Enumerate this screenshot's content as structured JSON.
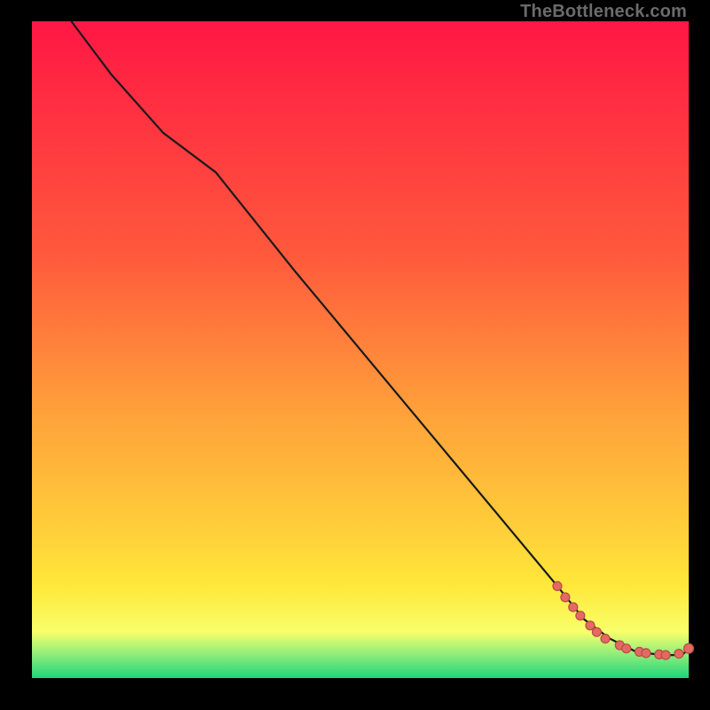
{
  "watermark": "TheBottleneck.com",
  "colors": {
    "gradient": [
      "#ff1744",
      "#ff5a3c",
      "#ffa23a",
      "#ffd03a",
      "#ffe83a",
      "#f8ff6a",
      "#9aef7a",
      "#1fd67a"
    ],
    "dot_fill": "#e36a62",
    "dot_stroke": "#b84b44",
    "curve": "#1a1a1a"
  },
  "chart_data": {
    "type": "line",
    "title": "",
    "xlabel": "",
    "ylabel": "",
    "xlim": [
      0,
      100
    ],
    "ylim": [
      0,
      100
    ],
    "grid": false,
    "annotations": [
      "TheBottleneck.com"
    ],
    "series": [
      {
        "name": "curve",
        "x": [
          6,
          12,
          20,
          28,
          40,
          55,
          70,
          80,
          84,
          88,
          92,
          96,
          99,
          100
        ],
        "y": [
          100,
          92,
          83,
          77,
          62,
          44,
          26,
          14,
          9,
          6,
          4,
          3.5,
          3.5,
          4.5
        ]
      }
    ],
    "points": [
      {
        "x": 80.0,
        "y": 14.0
      },
      {
        "x": 81.2,
        "y": 12.3
      },
      {
        "x": 82.4,
        "y": 10.8
      },
      {
        "x": 83.5,
        "y": 9.5
      },
      {
        "x": 85.0,
        "y": 8.0
      },
      {
        "x": 86.0,
        "y": 7.0
      },
      {
        "x": 87.3,
        "y": 6.0
      },
      {
        "x": 89.5,
        "y": 5.0
      },
      {
        "x": 90.5,
        "y": 4.5
      },
      {
        "x": 92.5,
        "y": 4.0
      },
      {
        "x": 93.5,
        "y": 3.8
      },
      {
        "x": 95.5,
        "y": 3.6
      },
      {
        "x": 96.5,
        "y": 3.5
      },
      {
        "x": 98.5,
        "y": 3.7
      },
      {
        "x": 100.0,
        "y": 4.5
      }
    ]
  }
}
